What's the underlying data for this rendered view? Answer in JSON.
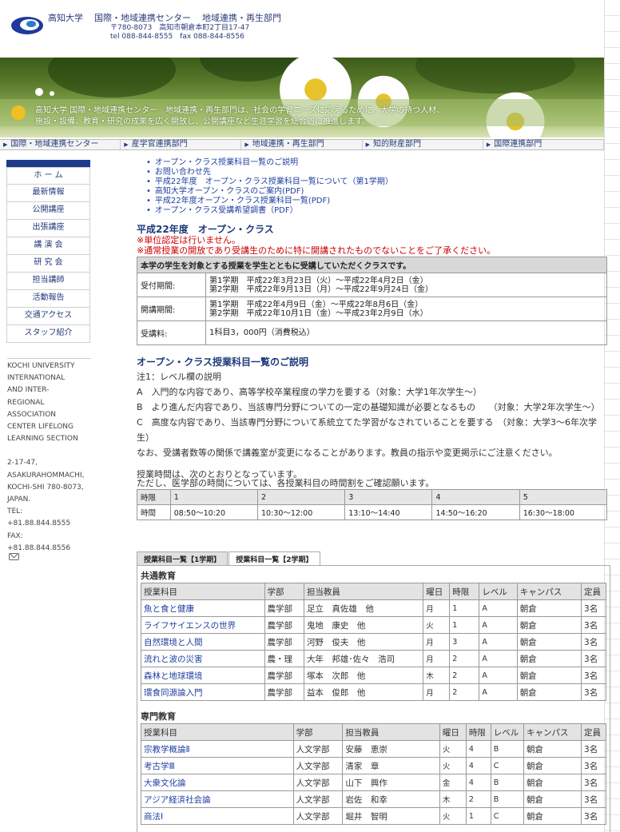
{
  "header": {
    "org_parts": [
      "高知大学",
      "国際・地域連携センター",
      "地域連携・再生部門"
    ],
    "address": "〒780-8073　高知市朝倉本町2丁目17-47",
    "tel": "tel 088-844-8555　fax 088-844-8556"
  },
  "banner": {
    "line1": "高知大学 国際・地域連携センター　地域連携・再生部門は、社会の学習ニーズに応えるために、大学の持つ人材、",
    "line2": "施設・設備、教育・研究の成果を広く開放し、公開講座など生涯学習を総合的に推進します。"
  },
  "deptnav": [
    "国際・地域連携センター",
    "産学官連携部門",
    "地域連携・再生部門",
    "知的財産部門",
    "国際連携部門"
  ],
  "sidebar": [
    "ホ ー ム",
    "最新情報",
    "公開講座",
    "出張講座",
    "講 演 会",
    "研 究 会",
    "担当講師",
    "活動報告",
    "交通アクセス",
    "スタッフ紹介"
  ],
  "sideinfo": [
    "KOCHI UNIVERSITY",
    "INTERNATIONAL",
    "AND INTER-",
    "REGIONAL",
    "ASSOCIATION",
    "CENTER LIFELONG",
    "LEARNING SECTION",
    "",
    "2-17-47,",
    "ASAKURAHOMMACHI,",
    "KOCHI-SHI 780-8073,",
    "JAPAN.",
    "TEL:",
    "+81.88.844.8555",
    "FAX:",
    "+81.88.844.8556"
  ],
  "links": [
    "オープン・クラス授業科目一覧のご説明",
    "お問い合わせ先",
    "平成22年度　オープン・クラス授業科目一覧について（第1学期）",
    "高知大学オープン・クラスのご案内(PDF)",
    "平成22年度オープン・クラス授業科目一覧(PDF)",
    "オープン・クラス受講希望調書（PDF）"
  ],
  "section": {
    "title": "平成22年度　オープン・クラス",
    "note1": "※単位認定は行いません。",
    "note2": "※通常授業の開放であり受講生のために特に開講されたものでないことをご了承ください。"
  },
  "period_table": {
    "header": "本学の学生を対象とする授業を学生とともに受講していただくクラスです。",
    "rows": [
      {
        "key": "受付期間:",
        "lines": [
          "第1学期　平成22年3月23日（火）～平成22年4月2日（金）",
          "第2学期　平成22年9月13日（月）～平成22年9月24日（金）"
        ]
      },
      {
        "key": "開講期間:",
        "lines": [
          "第1学期　平成22年4月9日（金）～平成22年8月6日（金）",
          "第2学期　平成22年10月1日（金）～平成23年2月9日（水）"
        ]
      },
      {
        "key": "受講料:",
        "lines": [
          "1科目3，000円（消費税込）"
        ]
      }
    ]
  },
  "explain": {
    "title": "オープン・クラス授業科目一覧のご説明",
    "paras": [
      "注1：レベル欄の説明",
      "A　入門的な内容であり、高等学校卒業程度の学力を要する（対象：大学1年次学生～）",
      "B　より進んだ内容であり、当該専門分野についての一定の基礎知識が必要となるもの　　（対象：大学2年次学生～）",
      "C　高度な内容であり、当該専門分野について系統立てた学習がなされていることを要する　（対象：大学3～6年次学生）",
      "なお、受講者数等の関係で講義室が変更になることがあります。教員の指示や変更掲示にご注意ください。"
    ]
  },
  "time": {
    "line1": "授業時間は、次のとおりとなっています。",
    "line2": "ただし、医学部の時間については、各授業科目の時間割をご確認願います。",
    "rows": [
      [
        "時限",
        "1",
        "2",
        "3",
        "4",
        "5"
      ],
      [
        "時間",
        "08:50～10:20",
        "10:30～12:00",
        "13:10～14:40",
        "14:50～16:20",
        "16:30～18:00"
      ]
    ]
  },
  "tabs": [
    "授業科目一覧【1学期】",
    "授業科目一覧【2学期】"
  ],
  "courses": [
    {
      "title": "共通教育",
      "header": [
        "授業科目",
        "学部",
        "担当教員",
        "曜日",
        "時限",
        "レベル",
        "キャンパス",
        "定員"
      ],
      "rows": [
        [
          "魚と食と健康",
          "農学部",
          "足立　真佐雄　他",
          "月",
          "1",
          "A",
          "朝倉",
          "3名"
        ],
        [
          "ライフサイエンスの世界",
          "農学部",
          "鬼地　康史　他",
          "火",
          "1",
          "A",
          "朝倉",
          "3名"
        ],
        [
          "自然環境と人間",
          "農学部",
          "河野　俊夫　他",
          "月",
          "3",
          "A",
          "朝倉",
          "3名"
        ],
        [
          "流れと波の災害",
          "農・理",
          "大年　邦雄･佐々　浩司",
          "月",
          "2",
          "A",
          "朝倉",
          "3名"
        ],
        [
          "森林と地球環境",
          "農学部",
          "塚本　次郎　他",
          "木",
          "2",
          "A",
          "朝倉",
          "3名"
        ],
        [
          "環食同源論入門",
          "農学部",
          "益本　俊郎　他",
          "月",
          "2",
          "A",
          "朝倉",
          "3名"
        ]
      ]
    },
    {
      "title": "専門教育",
      "header": [
        "授業科目",
        "学部",
        "担当教員",
        "曜日",
        "時限",
        "レベル",
        "キャンパス",
        "定員"
      ],
      "rows": [
        [
          "宗教学概論Ⅱ",
          "人文学部",
          "安藤　恵崇",
          "火",
          "4",
          "B",
          "朝倉",
          "3名"
        ],
        [
          "考古学Ⅲ",
          "人文学部",
          "清家　章",
          "火",
          "4",
          "C",
          "朝倉",
          "3名"
        ],
        [
          "大衆文化論",
          "人文学部",
          "山下　興作",
          "金",
          "4",
          "B",
          "朝倉",
          "3名"
        ],
        [
          "アジア経済社会論",
          "人文学部",
          "岩佐　和幸",
          "木",
          "2",
          "B",
          "朝倉",
          "3名"
        ],
        [
          "商法Ⅰ",
          "人文学部",
          "堀井　智明",
          "火",
          "1",
          "C",
          "朝倉",
          "3名"
        ]
      ]
    }
  ]
}
